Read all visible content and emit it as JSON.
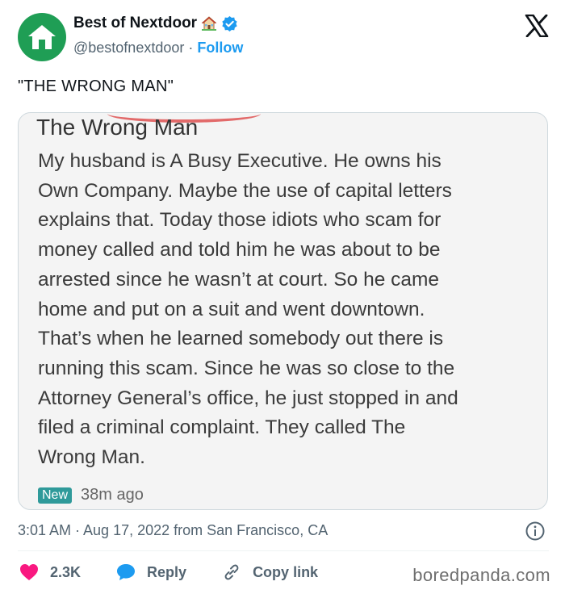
{
  "account": {
    "display_name": "Best of Nextdoor",
    "handle": "@bestofnextdoor",
    "separator": "·",
    "follow_label": "Follow"
  },
  "tweet": {
    "text": "\"THE WRONG MAN\""
  },
  "screenshot_post": {
    "title": "The Wrong Man",
    "lines": [
      "My husband is A Busy Executive. He owns his",
      "Own Company. Maybe the use of capital letters",
      "explains that. Today those idiots who scam for",
      "money called and told him he was about to be",
      "arrested since he wasn’t at court. So he came",
      "home and put on a suit and went downtown.",
      "That’s when he learned somebody out there is",
      "running this scam. Since he was so close to the",
      "Attorney General’s office, he just stopped in and",
      "filed a criminal complaint. They called The",
      "Wrong Man."
    ],
    "badge": "New",
    "time_ago": "38m ago"
  },
  "meta": {
    "timestamp": "3:01 AM · Aug 17, 2022 from San Francisco, CA"
  },
  "actions": {
    "likes": "2.3K",
    "reply_label": "Reply",
    "copy_label": "Copy link"
  },
  "watermark": "boredpanda.com",
  "colors": {
    "like_red": "#f91880",
    "reply_blue": "#1d9bf0",
    "link_blue": "#1d9bf0",
    "avatar_green": "#1f9e55",
    "badge_teal": "#2f9a9a"
  },
  "icons": [
    "house-emoji-icon",
    "verified-badge-icon",
    "x-logo-icon",
    "info-icon",
    "heart-icon",
    "reply-bubble-icon",
    "link-icon"
  ]
}
